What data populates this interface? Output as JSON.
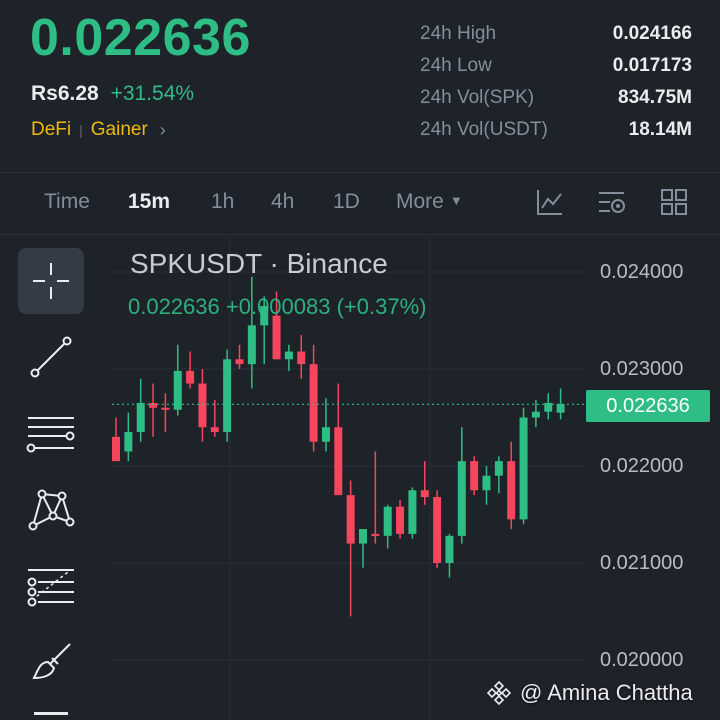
{
  "market": {
    "price": "0.022636",
    "fiat_price": "Rs6.28",
    "change_24h": "+31.54%",
    "tags": [
      "DeFi",
      "Gainer"
    ]
  },
  "stats": [
    {
      "label": "24h High",
      "value": "0.024166"
    },
    {
      "label": "24h Low",
      "value": "0.017173"
    },
    {
      "label": "24h Vol(SPK)",
      "value": "834.75M"
    },
    {
      "label": "24h Vol(USDT)",
      "value": "18.14M"
    }
  ],
  "tabs": {
    "time": "Time",
    "m15": "15m",
    "h1": "1h",
    "h4": "4h",
    "d1": "1D",
    "more": "More"
  },
  "chart": {
    "title": "SPKUSDT · Binance",
    "last_change": "0.022636 +0.000083 (+0.37%)",
    "current_price": "0.022636",
    "y_ticks": [
      "0.024000",
      "0.023000",
      "0.022000",
      "0.021000",
      "0.020000"
    ]
  },
  "watermark": {
    "text": "@ Amina Chattha"
  },
  "colors": {
    "up": "#2ebd85",
    "down": "#f6465d",
    "background": "#1e2229",
    "accent": "#f0b90b"
  },
  "chart_data": {
    "type": "candlestick",
    "interval": "15m",
    "ylim": [
      0.0199,
      0.0244
    ],
    "y_ticks": [
      0.024,
      0.023,
      0.022,
      0.021,
      0.02
    ],
    "current_price": 0.022636,
    "candles": [
      {
        "o": 0.0223,
        "h": 0.0225,
        "l": 0.0221,
        "c": 0.02205
      },
      {
        "o": 0.02215,
        "h": 0.02255,
        "l": 0.02205,
        "c": 0.02235
      },
      {
        "o": 0.02235,
        "h": 0.0229,
        "l": 0.02225,
        "c": 0.02265
      },
      {
        "o": 0.02265,
        "h": 0.02285,
        "l": 0.0223,
        "c": 0.0226
      },
      {
        "o": 0.0226,
        "h": 0.02275,
        "l": 0.02235,
        "c": 0.02258
      },
      {
        "o": 0.02258,
        "h": 0.02325,
        "l": 0.02252,
        "c": 0.02298
      },
      {
        "o": 0.02298,
        "h": 0.02318,
        "l": 0.0228,
        "c": 0.02285
      },
      {
        "o": 0.02285,
        "h": 0.023,
        "l": 0.02225,
        "c": 0.0224
      },
      {
        "o": 0.0224,
        "h": 0.02268,
        "l": 0.0223,
        "c": 0.02235
      },
      {
        "o": 0.02235,
        "h": 0.0232,
        "l": 0.02225,
        "c": 0.0231
      },
      {
        "o": 0.0231,
        "h": 0.02325,
        "l": 0.023,
        "c": 0.02305
      },
      {
        "o": 0.02305,
        "h": 0.02395,
        "l": 0.0228,
        "c": 0.02345
      },
      {
        "o": 0.02345,
        "h": 0.02375,
        "l": 0.02305,
        "c": 0.02365
      },
      {
        "o": 0.02355,
        "h": 0.0238,
        "l": 0.0231,
        "c": 0.0231
      },
      {
        "o": 0.0231,
        "h": 0.02325,
        "l": 0.02298,
        "c": 0.02318
      },
      {
        "o": 0.02318,
        "h": 0.02335,
        "l": 0.0229,
        "c": 0.02305
      },
      {
        "o": 0.02305,
        "h": 0.02325,
        "l": 0.02215,
        "c": 0.02225
      },
      {
        "o": 0.02225,
        "h": 0.0227,
        "l": 0.02215,
        "c": 0.0224
      },
      {
        "o": 0.0224,
        "h": 0.02285,
        "l": 0.02175,
        "c": 0.0217
      },
      {
        "o": 0.0217,
        "h": 0.02185,
        "l": 0.02045,
        "c": 0.0212
      },
      {
        "o": 0.0212,
        "h": 0.02135,
        "l": 0.02095,
        "c": 0.02135
      },
      {
        "o": 0.0213,
        "h": 0.02215,
        "l": 0.0212,
        "c": 0.02128
      },
      {
        "o": 0.02128,
        "h": 0.0216,
        "l": 0.02115,
        "c": 0.02158
      },
      {
        "o": 0.02158,
        "h": 0.02165,
        "l": 0.02125,
        "c": 0.0213
      },
      {
        "o": 0.0213,
        "h": 0.02178,
        "l": 0.02125,
        "c": 0.02175
      },
      {
        "o": 0.02175,
        "h": 0.02205,
        "l": 0.0216,
        "c": 0.02168
      },
      {
        "o": 0.02168,
        "h": 0.02175,
        "l": 0.02095,
        "c": 0.021
      },
      {
        "o": 0.021,
        "h": 0.0213,
        "l": 0.02085,
        "c": 0.02128
      },
      {
        "o": 0.02128,
        "h": 0.0224,
        "l": 0.0212,
        "c": 0.02205
      },
      {
        "o": 0.02205,
        "h": 0.0221,
        "l": 0.0217,
        "c": 0.02175
      },
      {
        "o": 0.02175,
        "h": 0.022,
        "l": 0.0216,
        "c": 0.0219
      },
      {
        "o": 0.0219,
        "h": 0.0221,
        "l": 0.02172,
        "c": 0.02205
      },
      {
        "o": 0.02205,
        "h": 0.02225,
        "l": 0.02135,
        "c": 0.02145
      },
      {
        "o": 0.02145,
        "h": 0.0226,
        "l": 0.0214,
        "c": 0.0225
      },
      {
        "o": 0.0225,
        "h": 0.02268,
        "l": 0.0224,
        "c": 0.02256
      },
      {
        "o": 0.02256,
        "h": 0.02275,
        "l": 0.02248,
        "c": 0.02265
      },
      {
        "o": 0.02255,
        "h": 0.0228,
        "l": 0.02248,
        "c": 0.02264
      }
    ]
  }
}
